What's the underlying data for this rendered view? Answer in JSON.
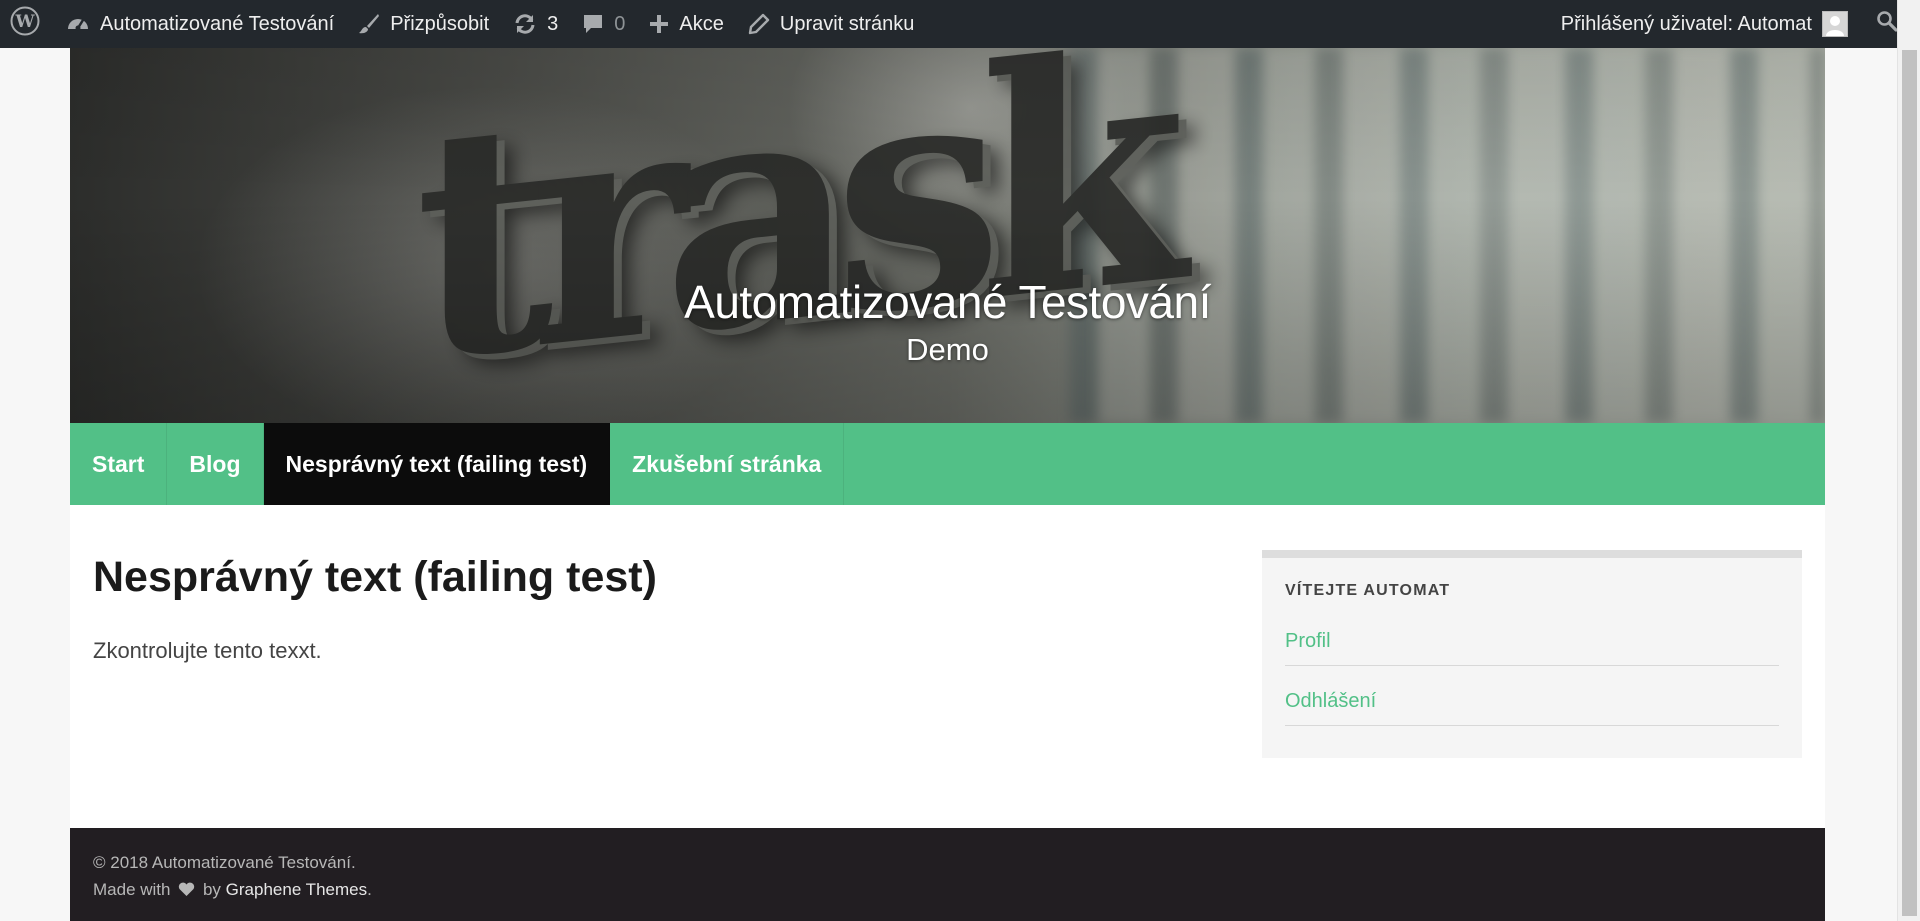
{
  "admin_bar": {
    "site_name": "Automatizované Testování",
    "customize": "Přizpůsobit",
    "updates_count": "3",
    "comments_count": "0",
    "new_label": "Akce",
    "edit_label": "Upravit stránku",
    "user_greeting": "Přihlášený uživatel: Automat",
    "icons": [
      "wordpress-icon",
      "dashboard-icon",
      "brush-icon",
      "updates-icon",
      "comment-icon",
      "plus-icon",
      "pencil-icon",
      "avatar",
      "search-icon"
    ]
  },
  "header": {
    "title": "Automatizované Testování",
    "description": "Demo",
    "logo_text": "trask"
  },
  "nav": {
    "items": [
      {
        "label": "Start"
      },
      {
        "label": "Blog"
      },
      {
        "label": "Nesprávný text (failing test)",
        "active": true
      },
      {
        "label": "Zkušební stránka"
      }
    ]
  },
  "main": {
    "title": "Nesprávný text (failing test)",
    "body": "Zkontrolujte tento texxt."
  },
  "widget": {
    "title": "VÍTEJTE AUTOMAT",
    "links": [
      "Profil",
      "Odhlášení"
    ]
  },
  "footer": {
    "copyright": "© 2018 Automatizované Testování.",
    "made_with": "Made with",
    "by": "by",
    "theme_link": "Graphene Themes",
    "period": "."
  },
  "colors": {
    "admin_bar_bg": "#23282d",
    "nav_green": "#52c087",
    "nav_active": "#0c0c0c",
    "link_green": "#52c087",
    "footer_bg": "#221e22"
  }
}
